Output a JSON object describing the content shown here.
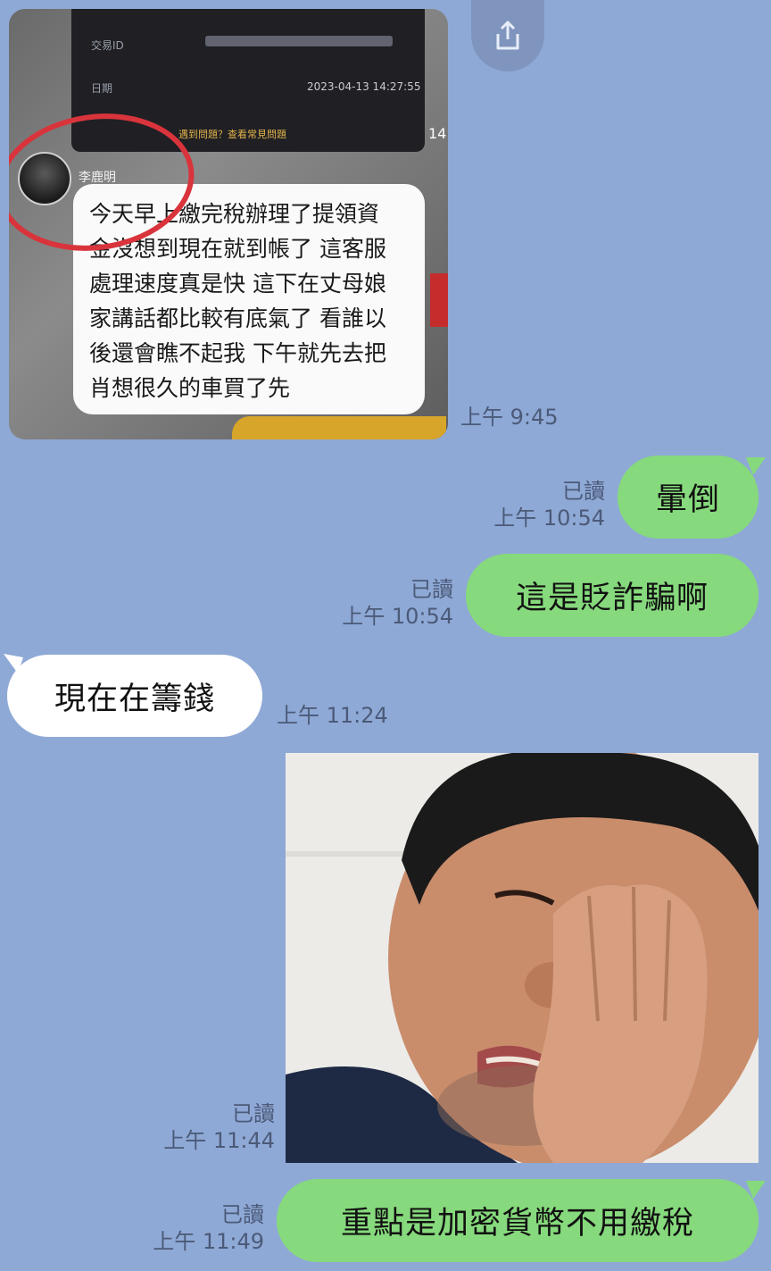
{
  "share_button": {
    "icon": "share-icon"
  },
  "shared_screenshot": {
    "card_row1_label": "交易ID",
    "card_row2_label": "日期",
    "card_date": "2023-04-13 14:27:55",
    "card_notice": "遇到問題？查看常見問題",
    "side_time": "14:",
    "username": "李鹿明",
    "post_lines": [
      "今天早上繳完稅辦理了提領資",
      "金沒想到現在就到帳了 這客服",
      "處理速度真是快 這下在丈母娘",
      "家講話都比較有底氣了 看誰以",
      "後還會瞧不起我 下午就先去把",
      "肖想很久的車買了先"
    ]
  },
  "messages": [
    {
      "id": "m1",
      "type": "image",
      "time": "上午 9:45"
    },
    {
      "id": "m2",
      "type": "text",
      "direction": "out",
      "text": "暈倒",
      "read": "已讀",
      "time": "上午 10:54"
    },
    {
      "id": "m3",
      "type": "text",
      "direction": "out",
      "text": "這是貶詐騙啊",
      "read": "已讀",
      "time": "上午 10:54"
    },
    {
      "id": "m4",
      "type": "text",
      "direction": "in",
      "text": "現在在籌錢",
      "time": "上午 11:24"
    },
    {
      "id": "m5",
      "type": "image",
      "direction": "out",
      "read": "已讀",
      "time": "上午 11:44"
    },
    {
      "id": "m6",
      "type": "text",
      "direction": "out",
      "text": "重點是加密貨幣不用繳稅",
      "read": "已讀",
      "time": "上午 11:49"
    }
  ],
  "colors": {
    "background": "#8fa9d6",
    "outgoing_bubble": "#86d97c",
    "incoming_bubble": "#ffffff",
    "meta_text": "#4b5a78"
  }
}
